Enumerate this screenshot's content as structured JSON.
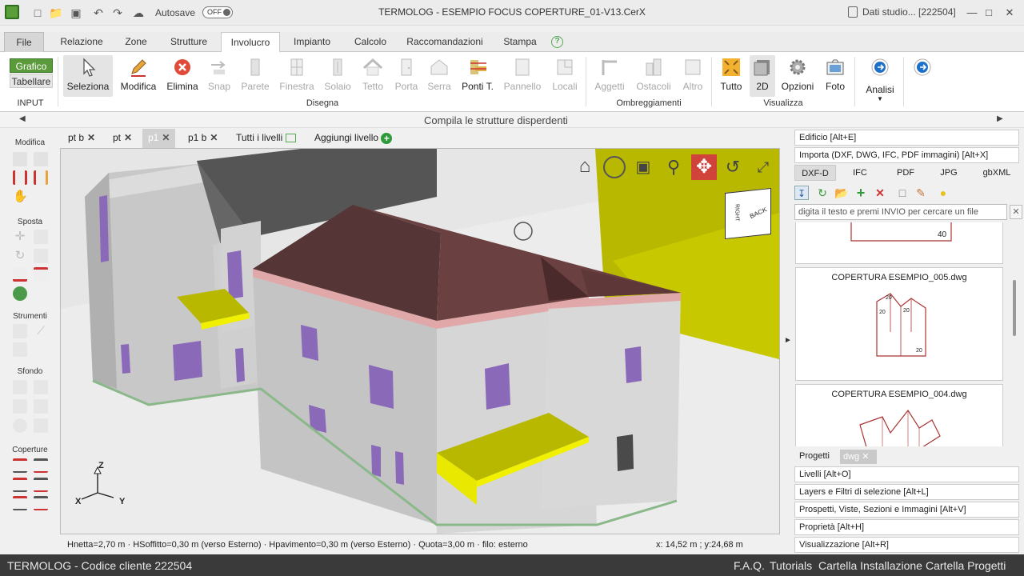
{
  "window": {
    "title": "TERMOLOG - ESEMPIO FOCUS COPERTURE_01-V13.CerX",
    "autosave_label": "Autosave",
    "autosave_state": "OFF",
    "user": "Dati studio... [222504]"
  },
  "menu_tabs": [
    "File",
    "Relazione",
    "Zone",
    "Strutture",
    "Involucro",
    "Impianto",
    "Calcolo",
    "Raccomandazioni",
    "Stampa"
  ],
  "menu_active": "Involucro",
  "ribbon": {
    "input_toggle": {
      "grafico": "Grafico",
      "tabellare": "Tabellare",
      "group": "INPUT"
    },
    "disegna": [
      "Seleziona",
      "Modifica",
      "Elimina",
      "Snap",
      "Parete",
      "Finestra",
      "Solaio",
      "Tetto",
      "Porta",
      "Serra",
      "Ponti T.",
      "Pannello",
      "Locali"
    ],
    "disegna_group": "Disegna",
    "ombreggiamenti": [
      "Aggetti",
      "Ostacoli",
      "Altro"
    ],
    "ombreggiamenti_group": "Ombreggiamenti",
    "visualizza": [
      "Tutto",
      "2D",
      "Opzioni",
      "Foto"
    ],
    "visualizza_group": "Visualizza",
    "analisi": "Analisi"
  },
  "compile_bar": "Compila le strutture disperdenti",
  "left_toolbar": {
    "sections": [
      "Modifica",
      "Sposta",
      "Strumenti",
      "Sfondo",
      "Coperture"
    ]
  },
  "level_tabs": [
    {
      "label": "pt b",
      "active": false
    },
    {
      "label": "pt",
      "active": false
    },
    {
      "label": "p1",
      "active": true
    },
    {
      "label": "p1 b",
      "active": false
    }
  ],
  "all_levels": "Tutti i livelli",
  "add_level": "Aggiungi livello",
  "viewcube": {
    "left": "RIGHT",
    "right": "BACK"
  },
  "axes": {
    "x": "X",
    "y": "Y",
    "z": "Z"
  },
  "status": {
    "info": "Hnetta=2,70 m · HSoffitto=0,30 m (verso Esterno) · Hpavimento=0,30 m (verso Esterno) · Quota=3,00 m · filo: esterno",
    "coords": "x:  14,52 m ; y:24,68 m"
  },
  "bottom_bar": {
    "left": "TERMOLOG - Codice cliente 222504",
    "links": [
      "F.A.Q.",
      "Tutorials",
      "Cartella Installazione",
      "Cartella Progetti"
    ]
  },
  "right_panel": {
    "edificio": "Edificio [Alt+E]",
    "importa": "Importa (DXF, DWG, IFC, PDF immagini) [Alt+X]",
    "format_tabs": [
      "DXF-D",
      "IFC",
      "PDF",
      "JPG",
      "gbXML"
    ],
    "search_placeholder": "digita il testo e premi INVIO per cercare un file",
    "files": [
      {
        "name": "",
        "label": "40"
      },
      {
        "name": "COPERTURA ESEMPIO_005.dwg",
        "labels": [
          "20",
          "20",
          "20",
          "20"
        ]
      },
      {
        "name": "COPERTURA ESEMPIO_004.dwg"
      }
    ],
    "bottom_tabs": [
      "Progetti",
      "dwg"
    ],
    "panels": [
      "Livelli [Alt+O]",
      "Layers e Filtri di selezione [Alt+L]",
      "Prospetti, Viste, Sezioni e Immagini [Alt+V]",
      "Proprietà [Alt+H]",
      "Visualizzazione [Alt+R]"
    ]
  }
}
